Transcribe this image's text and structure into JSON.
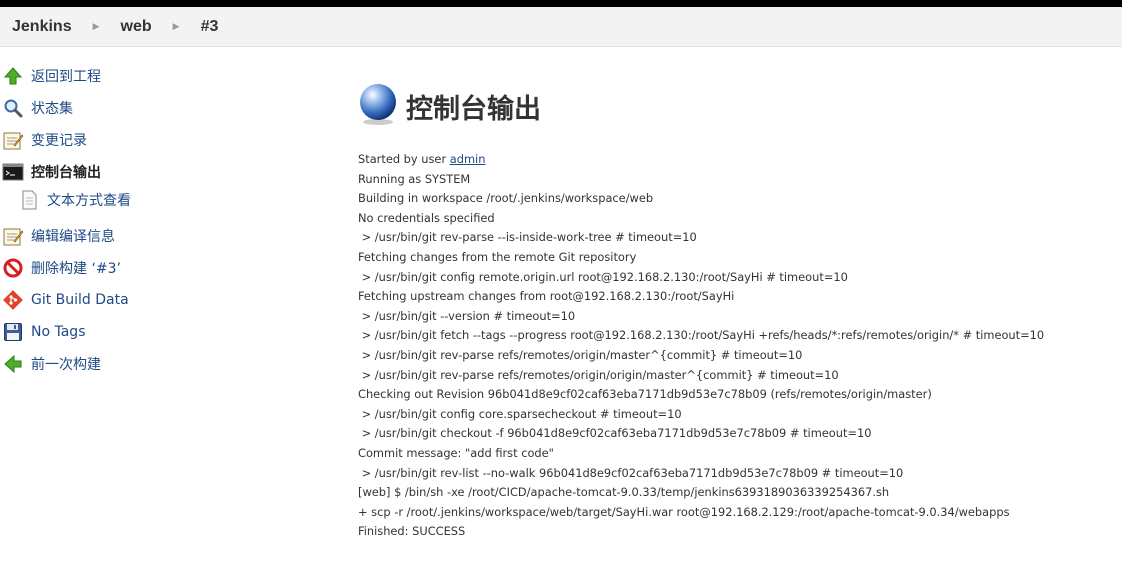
{
  "breadcrumb": {
    "items": [
      "Jenkins",
      "web",
      "#3"
    ]
  },
  "sidebar": {
    "items": [
      {
        "label": "返回到工程",
        "icon": "up-arrow-icon"
      },
      {
        "label": "状态集",
        "icon": "magnifier-icon"
      },
      {
        "label": "变更记录",
        "icon": "notepad-icon"
      },
      {
        "label": "控制台输出",
        "icon": "terminal-icon",
        "current": true
      },
      {
        "label": "文本方式查看",
        "icon": "document-icon",
        "sub": true
      },
      {
        "label": "编辑编译信息",
        "icon": "notepad-icon"
      },
      {
        "label": "删除构建 ‘#3’",
        "icon": "no-entry-icon"
      },
      {
        "label": "Git Build Data",
        "icon": "git-icon"
      },
      {
        "label": "No Tags",
        "icon": "save-disk-icon"
      },
      {
        "label": "前一次构建",
        "icon": "left-arrow-icon"
      }
    ]
  },
  "main": {
    "title": "控制台输出",
    "started_prefix": "Started by user ",
    "started_user": "admin",
    "console_lines": [
      "Running as SYSTEM",
      "Building in workspace /root/.jenkins/workspace/web",
      "No credentials specified",
      " > /usr/bin/git rev-parse --is-inside-work-tree # timeout=10",
      "Fetching changes from the remote Git repository",
      " > /usr/bin/git config remote.origin.url root@192.168.2.130:/root/SayHi # timeout=10",
      "Fetching upstream changes from root@192.168.2.130:/root/SayHi",
      " > /usr/bin/git --version # timeout=10",
      " > /usr/bin/git fetch --tags --progress root@192.168.2.130:/root/SayHi +refs/heads/*:refs/remotes/origin/* # timeout=10",
      " > /usr/bin/git rev-parse refs/remotes/origin/master^{commit} # timeout=10",
      " > /usr/bin/git rev-parse refs/remotes/origin/origin/master^{commit} # timeout=10",
      "Checking out Revision 96b041d8e9cf02caf63eba7171db9d53e7c78b09 (refs/remotes/origin/master)",
      " > /usr/bin/git config core.sparsecheckout # timeout=10",
      " > /usr/bin/git checkout -f 96b041d8e9cf02caf63eba7171db9d53e7c78b09 # timeout=10",
      "Commit message: \"add first code\"",
      " > /usr/bin/git rev-list --no-walk 96b041d8e9cf02caf63eba7171db9d53e7c78b09 # timeout=10",
      "[web] $ /bin/sh -xe /root/CICD/apache-tomcat-9.0.33/temp/jenkins6393189036339254367.sh",
      "+ scp -r /root/.jenkins/workspace/web/target/SayHi.war root@192.168.2.129:/root/apache-tomcat-9.0.34/webapps",
      "Finished: SUCCESS"
    ]
  },
  "colors": {
    "link": "#204a87",
    "breadcrumb_bg": "#f3f3f3",
    "topbar": "#000000"
  }
}
